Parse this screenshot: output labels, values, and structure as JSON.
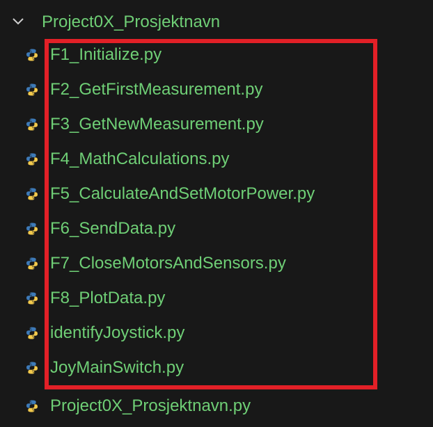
{
  "folder": {
    "name": "Project0X_Prosjektnavn",
    "expanded": true,
    "chevron_icon": "chevron-down-icon"
  },
  "files": [
    {
      "name": "F1_Initialize.py",
      "icon": "python-icon",
      "highlighted": true
    },
    {
      "name": "F2_GetFirstMeasurement.py",
      "icon": "python-icon",
      "highlighted": true
    },
    {
      "name": "F3_GetNewMeasurement.py",
      "icon": "python-icon",
      "highlighted": true
    },
    {
      "name": "F4_MathCalculations.py",
      "icon": "python-icon",
      "highlighted": true
    },
    {
      "name": "F5_CalculateAndSetMotorPower.py",
      "icon": "python-icon",
      "highlighted": true
    },
    {
      "name": "F6_SendData.py",
      "icon": "python-icon",
      "highlighted": true
    },
    {
      "name": "F7_CloseMotorsAndSensors.py",
      "icon": "python-icon",
      "highlighted": true
    },
    {
      "name": "F8_PlotData.py",
      "icon": "python-icon",
      "highlighted": true
    },
    {
      "name": "identifyJoystick.py",
      "icon": "python-icon",
      "highlighted": true
    },
    {
      "name": "JoyMainSwitch.py",
      "icon": "python-icon",
      "highlighted": true
    },
    {
      "name": "Project0X_Prosjektnavn.py",
      "icon": "python-icon",
      "highlighted": false
    }
  ],
  "colors": {
    "background": "#181818",
    "text": "#6fcf76",
    "highlight_border": "#e22027",
    "python_blue": "#3d7ab8",
    "python_yellow": "#f2c94c"
  }
}
